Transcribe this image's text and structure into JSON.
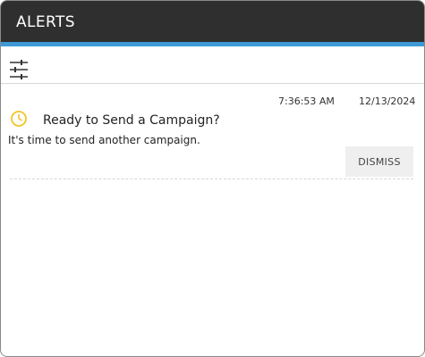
{
  "header": {
    "title": "ALERTS"
  },
  "toolbar": {
    "filter_icon": "sliders-icon"
  },
  "alerts": [
    {
      "time": "7:36:53 AM",
      "date": "12/13/2024",
      "icon": "clock-icon",
      "icon_color": "#f2c428",
      "title": "Ready to Send a Campaign?",
      "message": "It's time to send another campaign.",
      "dismiss_label": "DISMISS"
    }
  ],
  "colors": {
    "header_bg": "#2f2f2f",
    "accent": "#3d9ad6"
  }
}
